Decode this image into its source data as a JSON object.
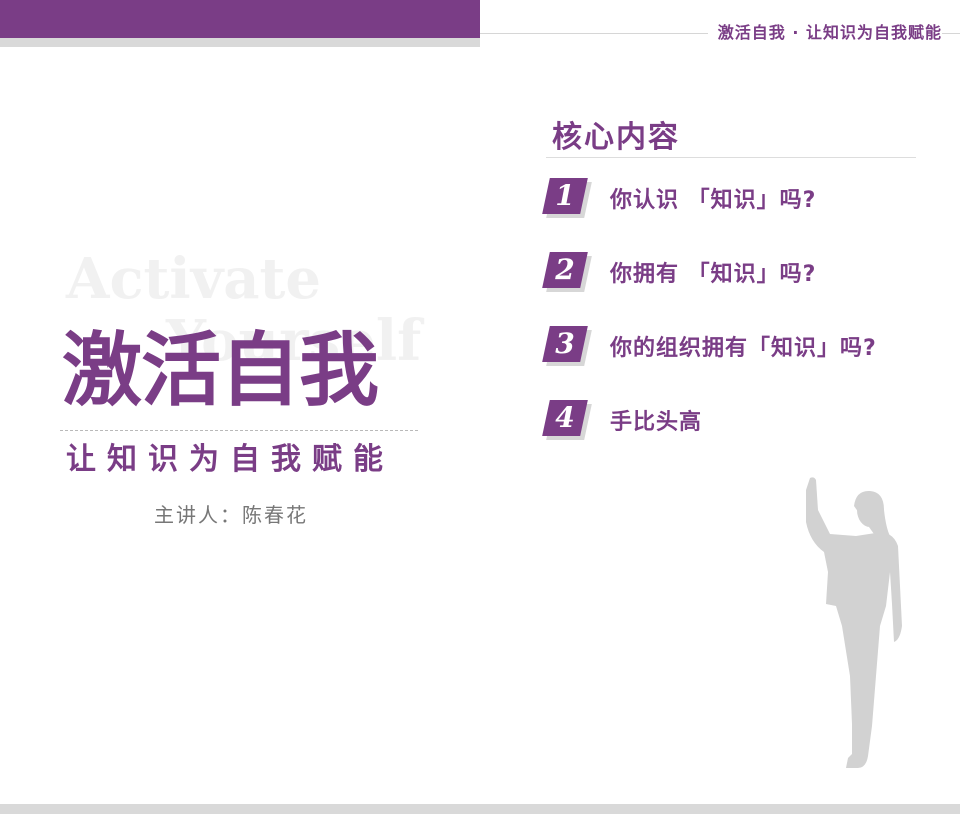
{
  "colors": {
    "brand": "#7a3d86",
    "light_gray": "#d9d9d9",
    "silhouette": "#d2d2d2"
  },
  "header": {
    "tagline": "激活自我 · 让知识为自我赋能"
  },
  "left": {
    "watermark": [
      "Activate",
      "Yourself"
    ],
    "title": "激活自我",
    "subtitle": "让知识为自我赋能",
    "speaker": "主讲人：陈春花"
  },
  "right": {
    "heading": "核心内容",
    "items": [
      {
        "number": "1",
        "text": "你认识 「知识」吗?"
      },
      {
        "number": "2",
        "text": "你拥有 「知识」吗?"
      },
      {
        "number": "3",
        "text": "你的组织拥有「知识」吗?"
      },
      {
        "number": "4",
        "text": "手比头高"
      }
    ]
  },
  "icons": {
    "figure": "woman-raising-hand-silhouette-icon"
  }
}
